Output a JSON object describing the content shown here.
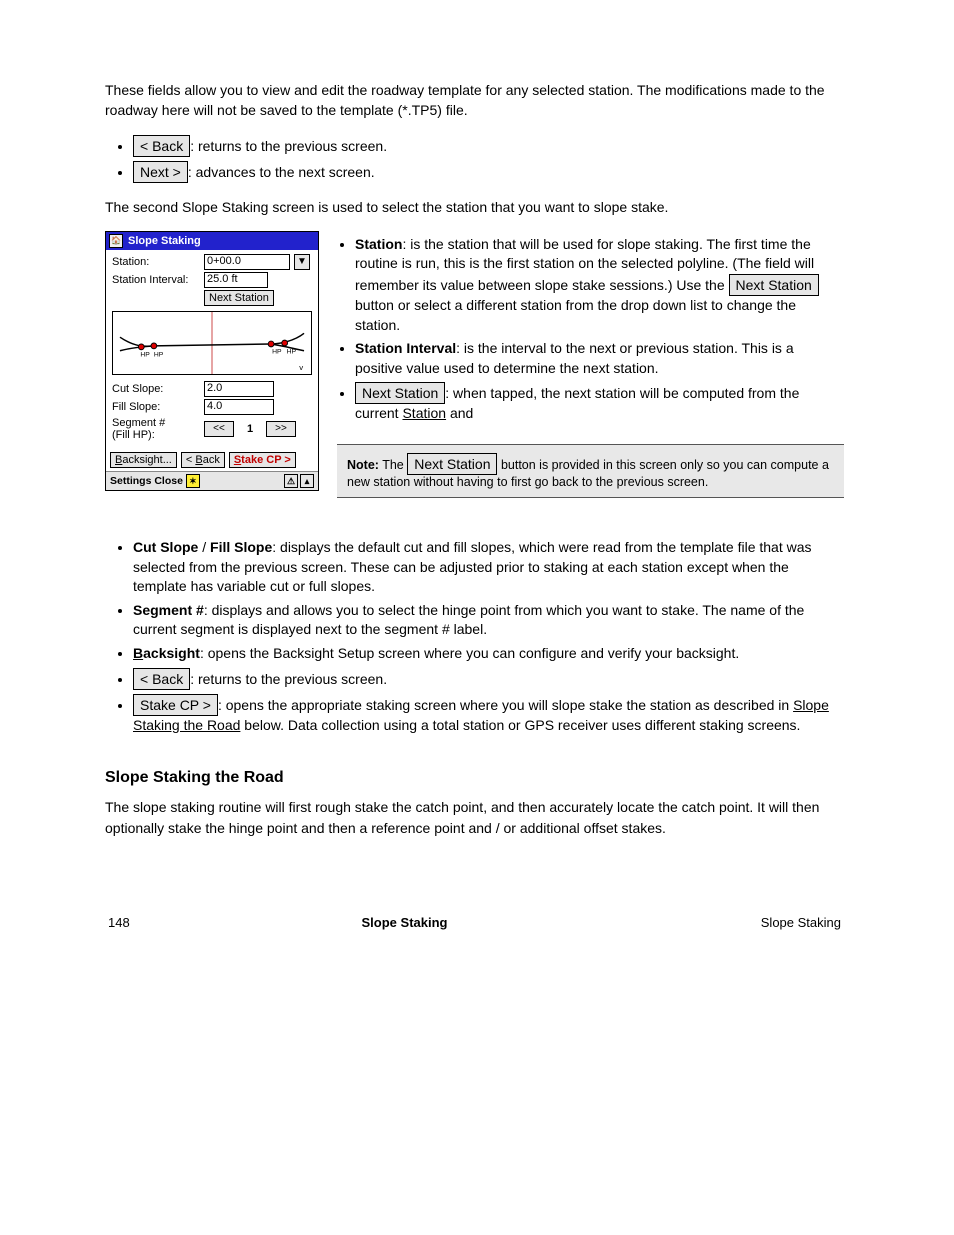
{
  "doc": {
    "heading_chapter": "Slope Staking",
    "heading_part": "Slope Staking",
    "heading_routine_title": "Slope Staking the Road",
    "page_number": "148",
    "p_intro_bullets_lead": "These fields allow you to view and edit the roadway template for any selected station. The modifications made to the roadway here will not be saved to the template (*.TP5) file.",
    "bullets_top": [
      {
        "label": "< Back",
        "desc": ": returns to the previous screen."
      },
      {
        "label": "Next >",
        "desc": ": advances to the next screen."
      }
    ],
    "second_screen_lead": "The second Slope Staking screen is used to select the station that you want to slope stake.",
    "right_col_bullets": [
      {
        "label": "Station",
        "desc": ": is the station that will be used for slope staking. The first time the routine is run, this is the first station on the selected polyline. (The field will remember its value between slope stake sessions.) Use the ",
        "tail_button": "Next Station",
        "tail": " button or select a different station from the drop down list to change the station."
      },
      {
        "label": "Station Interval",
        "desc": ": is the interval to the next or previous station. This is a positive value used to determine the next station."
      },
      {
        "label": "Next Station",
        "desc_before": ": when tapped, the next station will be computed from the current ",
        "link": "Station",
        "desc_after": " and"
      }
    ],
    "note_block": {
      "label": "Note:",
      "text": " The ",
      "btn": "Next Station",
      "tail": " button is provided in this screen only so you can compute a new station without having to first go back to the previous screen."
    },
    "bullets_mid": [
      {
        "label": "Cut Slope",
        "desc_before": " / ",
        "label2": "Fill Slope",
        "desc": ": displays the default cut and fill slopes, which were read from the template file that was selected from the previous screen. These can be adjusted prior to staking at each station except when the template has variable cut or full slopes."
      },
      {
        "label": "Segment #",
        "desc": ": displays and allows you to select the hinge point from which you want to stake. The name of the current segment is displayed next to the segment # label."
      },
      {
        "label": "Backsight",
        "underline_char": "B",
        "desc": ": opens the Backsight Setup screen where you can configure and verify your backsight."
      }
    ],
    "bullets_bottom": [
      {
        "label": "< Back",
        "desc": ": returns to the previous screen."
      },
      {
        "label": "Stake CP >",
        "desc_before": ": opens the appropriate staking screen where you will slope stake the station as described in ",
        "link": "Slope Staking the Road",
        "desc_after": " below. Data collection using a total station or GPS receiver uses different staking screens."
      }
    ],
    "routine_body": "The slope staking routine will first rough stake the catch point, and then accurately locate the catch point. It will then optionally stake the hinge point and then a reference point and / or additional offset stakes."
  },
  "handheld": {
    "title": "Slope Staking",
    "station_label": "Station:",
    "station_value": "0+00.0",
    "interval_label": "Station Interval:",
    "interval_value": "25.0 ft",
    "next_station_btn": "Next Station",
    "cut_label": "Cut Slope:",
    "cut_value": "2.0",
    "fill_label": "Fill Slope:",
    "fill_value": "4.0",
    "segment_label1": "Segment #",
    "segment_label2": "(Fill HP):",
    "segment_value": "1",
    "arrow_prev": "<<",
    "arrow_next": ">>",
    "foot_backsight": "Backsight...",
    "foot_back": "< Back",
    "foot_stake": "Stake CP >",
    "status_left1": "Settings",
    "status_left2": "Close",
    "plot_hp_lbl": "HP",
    "plot_v": "v"
  }
}
